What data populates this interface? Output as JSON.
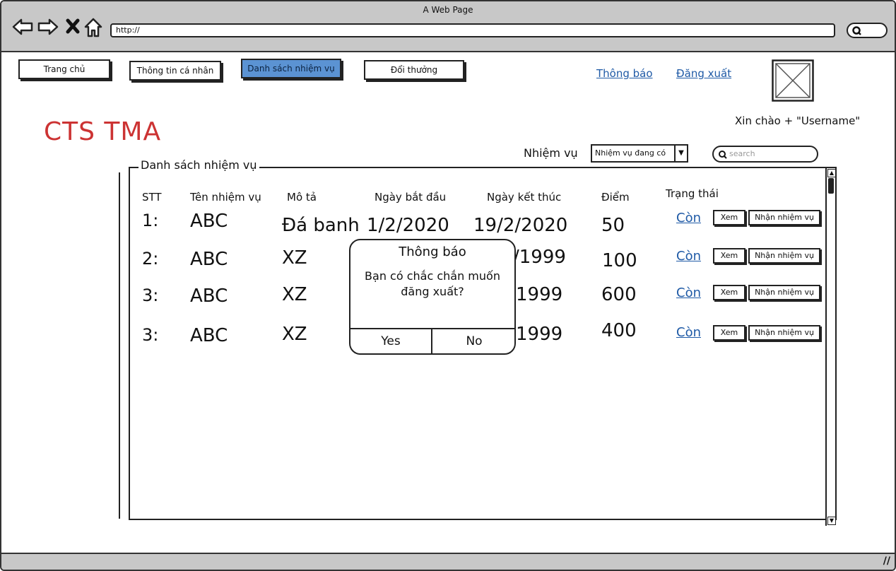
{
  "window": {
    "title": "A Web Page",
    "url": "http://"
  },
  "nav": {
    "home": "Trang chủ",
    "profile": "Thông tin cá nhân",
    "tasks": "Danh sách nhiệm vụ",
    "rewards": "Đổi thưởng",
    "notifications": "Thông báo",
    "logout": "Đăng xuất"
  },
  "greeting": "Xin chào + \"Username\"",
  "brand": "CTS TMA",
  "filter": {
    "label": "Nhiệm vụ",
    "selected": "Nhiệm vụ đang có",
    "search_placeholder": "search"
  },
  "table": {
    "legend": "Danh sách nhiệm vụ",
    "headers": {
      "stt": "STT",
      "name": "Tên nhiệm vụ",
      "desc": "Mô tả",
      "start": "Ngày bắt đầu",
      "end": "Ngày kết thúc",
      "points": "Điểm",
      "status": "Trạng thái"
    },
    "rows": [
      {
        "stt": "1:",
        "name": "ABC",
        "desc": "Đá banh",
        "start": "1/2/2020",
        "end": "19/2/2020",
        "points": "50",
        "status": "Còn"
      },
      {
        "stt": "2:",
        "name": "ABC",
        "desc": "XZ",
        "end": "/1999",
        "points": "100",
        "status": "Còn"
      },
      {
        "stt": "3:",
        "name": "ABC",
        "desc": "XZ",
        "end": "1999",
        "points": "600",
        "status": "Còn"
      },
      {
        "stt": "3:",
        "name": "ABC",
        "desc": "XZ",
        "end": "1999",
        "points": "400",
        "status": "Còn"
      }
    ],
    "view_label": "Xem",
    "accept_label": "Nhận nhiệm vụ"
  },
  "dialog": {
    "title": "Thông báo",
    "message": "Bạn có chắc chắn muốn đăng xuất?",
    "yes": "Yes",
    "no": "No"
  },
  "colors": {
    "brand": "#cc3333",
    "active_tab": "#5b93d3",
    "link": "#1f5aa6",
    "chrome": "#c8c8c8"
  }
}
